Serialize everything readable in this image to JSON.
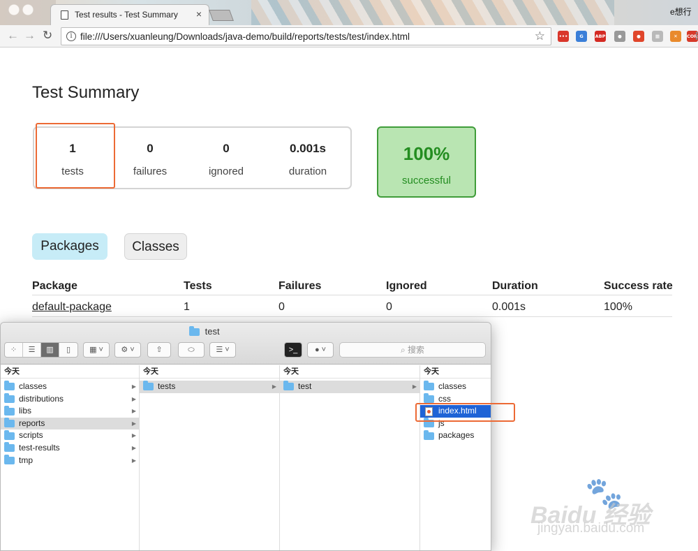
{
  "browser": {
    "tab_title": "Test results - Test Summary",
    "tab_close": "×",
    "profile_label": "e想行",
    "url": "file:///Users/xuanleung/Downloads/java-demo/build/reports/tests/test/index.html",
    "extensions": [
      {
        "name": "dots-extension-icon",
        "label": "•••",
        "color": "#d9362b"
      },
      {
        "name": "translate-extension-icon",
        "label": "G",
        "color": "#3b7fd8"
      },
      {
        "name": "abp-extension-icon",
        "label": "ABP",
        "color": "#d42a23"
      },
      {
        "name": "circle-extension-icon",
        "label": "●",
        "color": "#999999"
      },
      {
        "name": "record-extension-icon",
        "label": "●",
        "color": "#e0462b"
      },
      {
        "name": "grid-extension-icon",
        "label": "▦",
        "color": "#b9b9b9"
      },
      {
        "name": "cross-extension-icon",
        "label": "✕",
        "color": "#e98a2c"
      },
      {
        "name": "cors-extension-icon",
        "label": "CORS",
        "color": "#d63a2a"
      },
      {
        "name": "menu-icon",
        "label": "⋮",
        "color": "#8a8a8a"
      }
    ]
  },
  "report": {
    "title": "Test Summary",
    "counters": [
      {
        "value": "1",
        "label": "tests"
      },
      {
        "value": "0",
        "label": "failures"
      },
      {
        "value": "0",
        "label": "ignored"
      },
      {
        "value": "0.001s",
        "label": "duration"
      }
    ],
    "success": {
      "value": "100%",
      "label": "successful"
    },
    "tabs": [
      "Packages",
      "Classes"
    ],
    "table": {
      "headers": [
        "Package",
        "Tests",
        "Failures",
        "Ignored",
        "Duration",
        "Success rate"
      ],
      "rows": [
        [
          "default-package",
          "1",
          "0",
          "0",
          "0.001s",
          "100%"
        ]
      ]
    }
  },
  "finder": {
    "window_title": "test",
    "search_placeholder": "搜索",
    "columns": [
      {
        "header": "今天",
        "items": [
          {
            "label": "classes",
            "arrow": true
          },
          {
            "label": "distributions",
            "arrow": true
          },
          {
            "label": "libs",
            "arrow": true
          },
          {
            "label": "reports",
            "arrow": true,
            "selected": true
          },
          {
            "label": "scripts",
            "arrow": true
          },
          {
            "label": "test-results",
            "arrow": true
          },
          {
            "label": "tmp",
            "arrow": true
          }
        ]
      },
      {
        "header": "今天",
        "items": [
          {
            "label": "tests",
            "arrow": true,
            "selected": true
          }
        ]
      },
      {
        "header": "今天",
        "items": [
          {
            "label": "test",
            "arrow": true,
            "selected": true
          }
        ]
      },
      {
        "header": "今天",
        "items": [
          {
            "label": "classes"
          },
          {
            "label": "css"
          },
          {
            "label": "index.html",
            "file": true,
            "selected_blue": true
          },
          {
            "label": "js"
          },
          {
            "label": "packages"
          }
        ]
      }
    ]
  },
  "watermark": {
    "brand": "Baidu 经验",
    "sub": "jingyan.baidu.com"
  }
}
